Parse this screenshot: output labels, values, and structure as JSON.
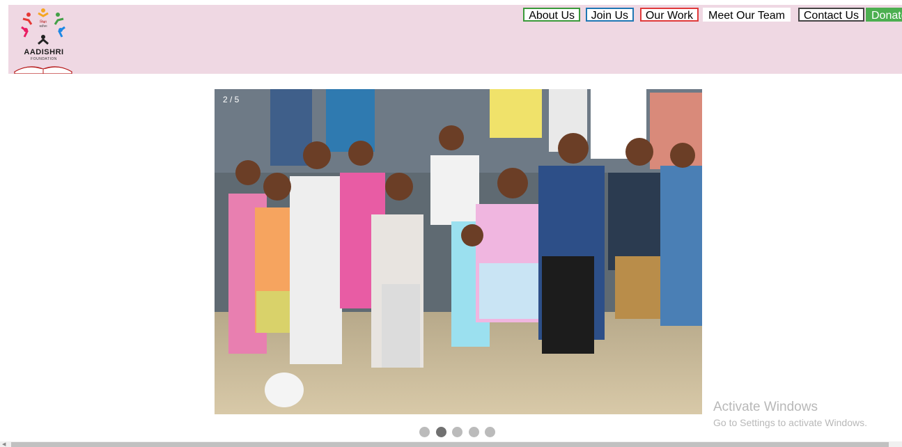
{
  "brand": {
    "name": "AADISHRI",
    "tagline": "FOUNDATION"
  },
  "nav": {
    "items": [
      {
        "label": "About Us",
        "border": "#3a9a3a"
      },
      {
        "label": "Join Us",
        "border": "#1f77b4"
      },
      {
        "label": "Our Work",
        "border": "#e03a3a"
      },
      {
        "label": "Meet Our Team",
        "border": "#ffffff"
      },
      {
        "label": "Contact Us",
        "border": "#444444"
      },
      {
        "label": "Donate",
        "border": "#4caf50",
        "fill": "#4caf50"
      }
    ]
  },
  "slideshow": {
    "counter": "2 / 5",
    "total_slides": 5,
    "active_index": 2
  },
  "watermark": {
    "title": "Activate Windows",
    "subtitle": "Go to Settings to activate Windows."
  },
  "colors": {
    "header_bg": "#efd8e3",
    "dot_inactive": "#bbbbbb",
    "dot_active": "#717171"
  }
}
